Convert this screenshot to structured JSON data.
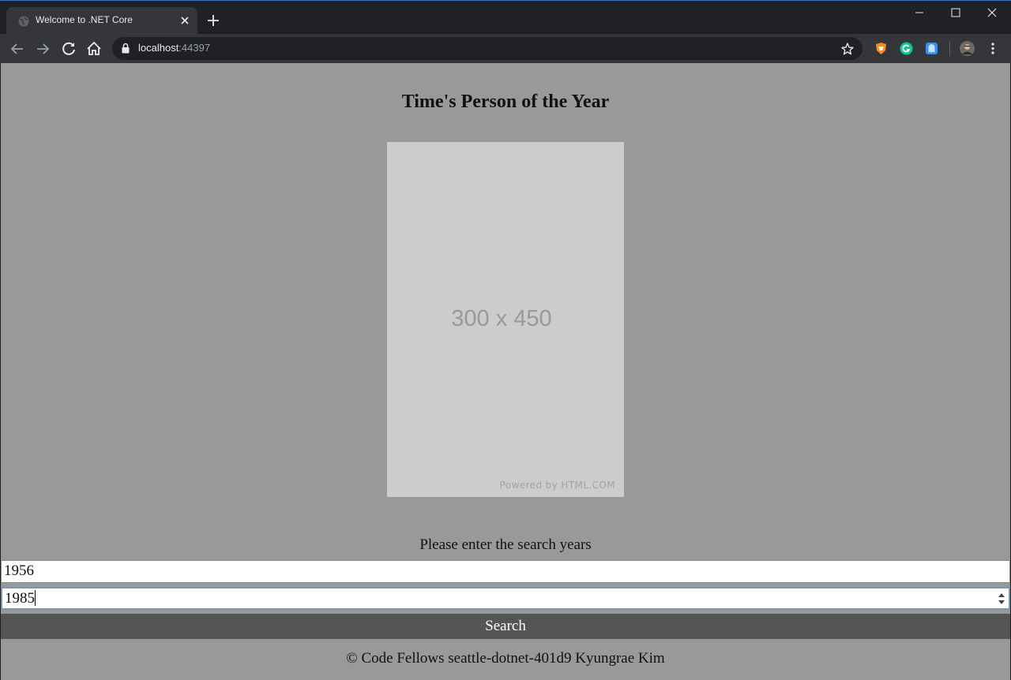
{
  "browser": {
    "tab": {
      "title": "Welcome to .NET Core"
    },
    "url": {
      "host": "localhost",
      "port": ":44397"
    }
  },
  "page": {
    "heading": "Time's Person of the Year",
    "image": {
      "size_text": "300 x 450",
      "credit": "Powered by HTML.COM"
    },
    "prompt": "Please enter the search years",
    "start_year": "1956",
    "end_year": "1985",
    "search_label": "Search",
    "footer": "© Code Fellows seattle-dotnet-401d9 Kyungrae Kim"
  },
  "colors": {
    "page_background": "#999999",
    "placeholder_background": "#cccccc",
    "search_button": "#555555",
    "chrome_dark": "#202124",
    "chrome_toolbar": "#35363a"
  },
  "icons": [
    "globe-icon",
    "close-icon",
    "plus-icon",
    "minimize-icon",
    "maximize-icon",
    "window-close-icon",
    "back-arrow-icon",
    "forward-arrow-icon",
    "reload-icon",
    "home-icon",
    "lock-icon",
    "star-icon",
    "brave-extension-icon",
    "grammarly-extension-icon",
    "ghost-extension-icon",
    "profile-avatar-icon",
    "more-menu-icon"
  ]
}
